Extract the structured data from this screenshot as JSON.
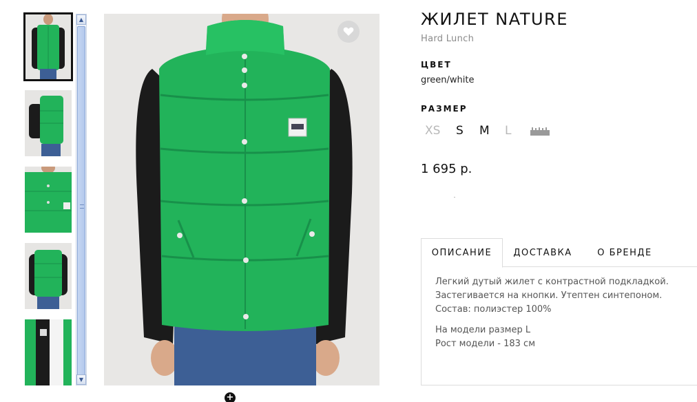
{
  "product": {
    "title": "ЖИЛЕТ NATURE",
    "brand": "Hard Lunch",
    "color_label": "ЦВЕТ",
    "color_value": "green/white",
    "size_label": "РАЗМЕР",
    "sizes": [
      {
        "label": "XS",
        "available": false
      },
      {
        "label": "S",
        "available": true
      },
      {
        "label": "M",
        "available": true
      },
      {
        "label": "L",
        "available": false
      }
    ],
    "price": "1 695 р."
  },
  "gallery": {
    "thumbnail_count": 5,
    "active_index": 0,
    "icons": {
      "favorite": "heart-icon",
      "zoom": "zoom-plus-icon",
      "size_chart": "ruler-icon"
    }
  },
  "tabs": [
    {
      "label": "ОПИСАНИЕ",
      "active": true
    },
    {
      "label": "ДОСТАВКА",
      "active": false
    },
    {
      "label": "О БРЕНДЕ",
      "active": false
    }
  ],
  "description": {
    "lines": [
      "Легкий дутый жилет с контрастной подкладкой.",
      "Застегивается на кнопки. Утептен синтепоном.",
      "Состав: полиэстер 100%"
    ],
    "model_lines": [
      "На модели размер L",
      "Рост модели - 183 см"
    ]
  },
  "colors": {
    "vest_green": "#22b35a",
    "vest_dark_green": "#18904a",
    "sleeve_black": "#1b1b1b",
    "jeans_blue": "#3d5f95",
    "skin": "#d9a98a"
  }
}
